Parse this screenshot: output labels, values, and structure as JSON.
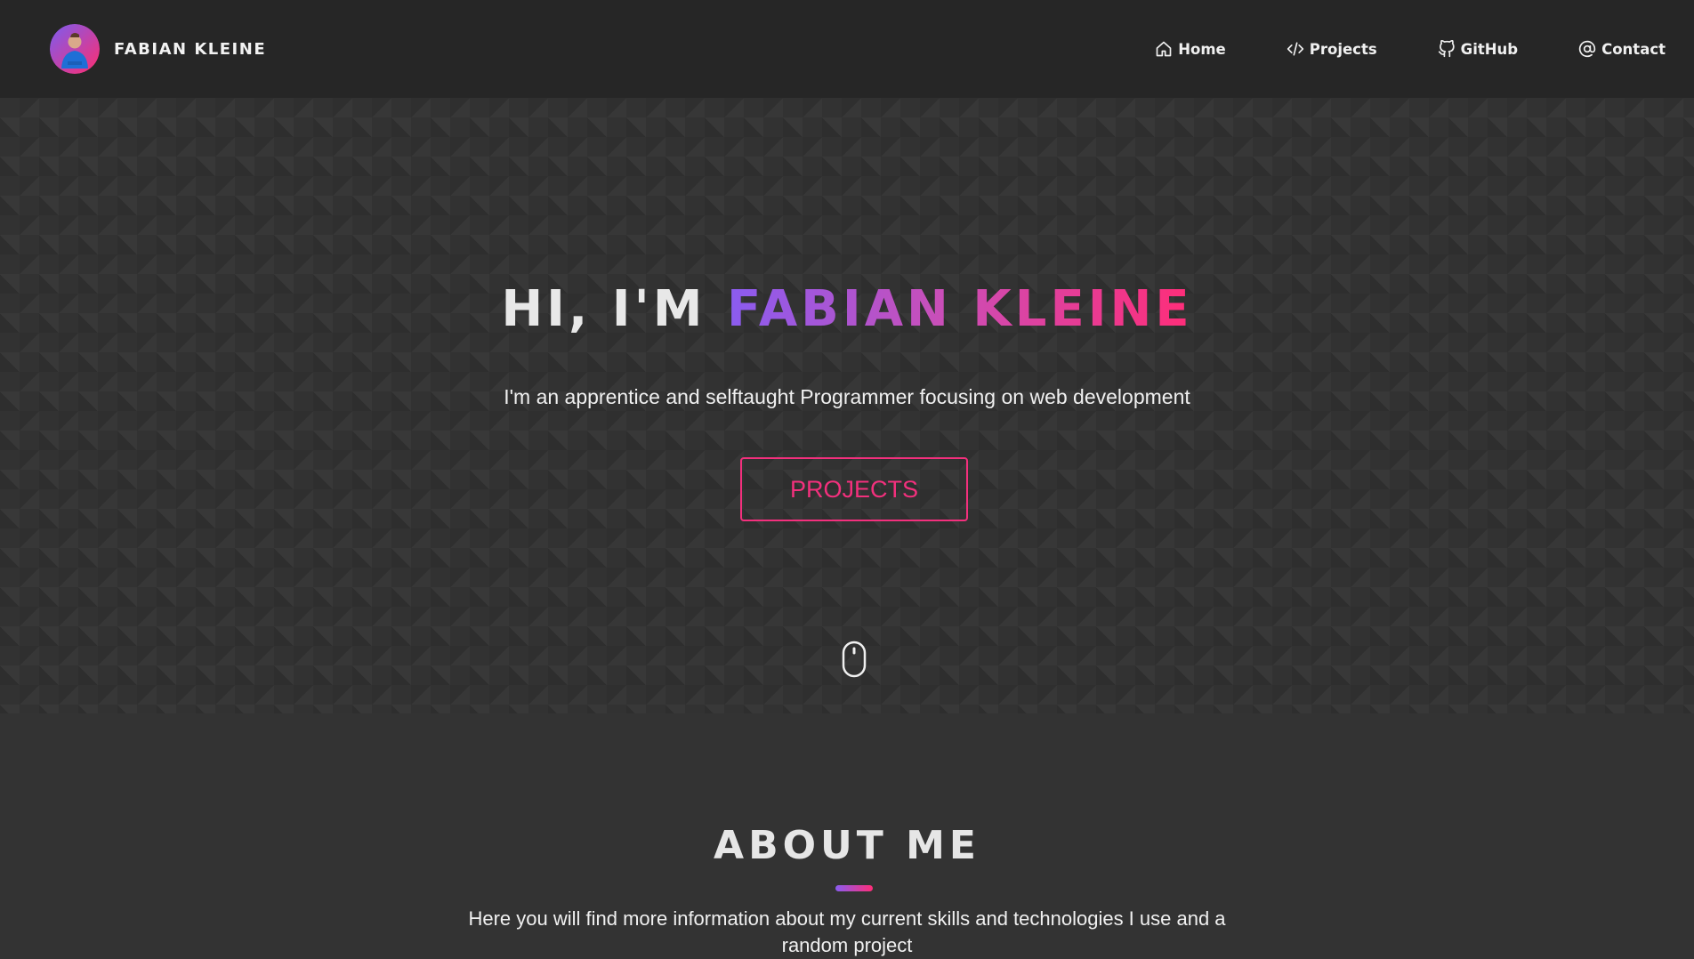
{
  "header": {
    "brand_name": "FABIAN KLEINE",
    "nav": [
      {
        "label": "Home",
        "icon": "home-icon"
      },
      {
        "label": "Projects",
        "icon": "code-icon"
      },
      {
        "label": "GitHub",
        "icon": "github-icon"
      },
      {
        "label": "Contact",
        "icon": "at-icon"
      }
    ]
  },
  "hero": {
    "title_prefix": "HI, I'M ",
    "title_name": "FABIAN KLEINE",
    "subtitle": "I'm an apprentice and selftaught Programmer focusing on web development",
    "button_label": "PROJECTS",
    "scroll_icon": "mouse-icon"
  },
  "about": {
    "title": "ABOUT ME",
    "text": "Here you will find more information about my current skills and technologies I use and a random project"
  },
  "colors": {
    "header_bg": "#262626",
    "page_bg": "#333333",
    "accent_pink": "#f3307d",
    "accent_purple": "#8a5cf0",
    "text_light": "#f0f0f0"
  }
}
